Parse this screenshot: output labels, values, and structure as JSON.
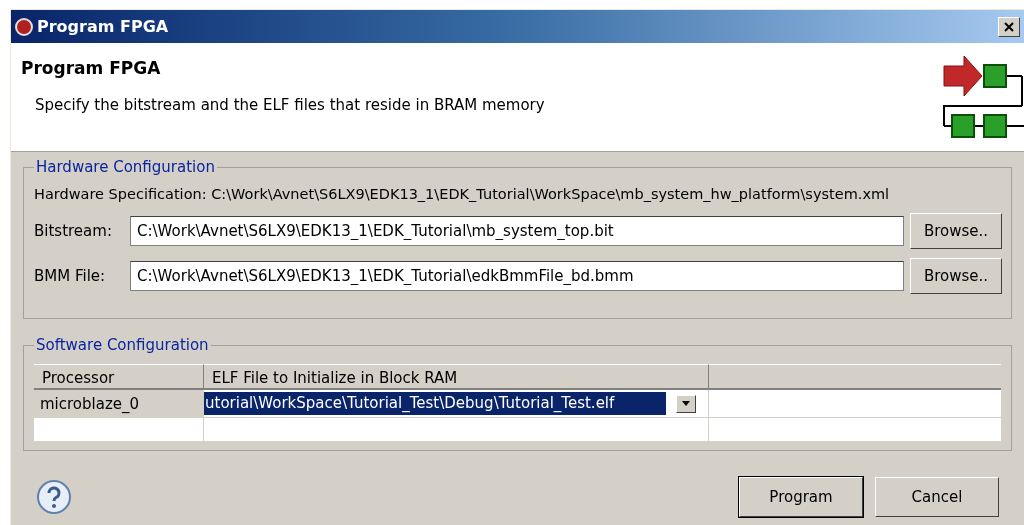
{
  "window": {
    "title": "Program FPGA"
  },
  "header": {
    "title": "Program FPGA",
    "description": "Specify the bitstream and the ELF files that reside in BRAM memory"
  },
  "hardware": {
    "legend": "Hardware Configuration",
    "spec_label": "Hardware Specification:",
    "spec_value": "C:\\Work\\Avnet\\S6LX9\\EDK13_1\\EDK_Tutorial\\WorkSpace\\mb_system_hw_platform\\system.xml",
    "fields": [
      {
        "label": "Bitstream:",
        "value": "C:\\Work\\Avnet\\S6LX9\\EDK13_1\\EDK_Tutorial\\mb_system_top.bit",
        "button": "Browse.."
      },
      {
        "label": "BMM File:",
        "value": "C:\\Work\\Avnet\\S6LX9\\EDK13_1\\EDK_Tutorial\\edkBmmFile_bd.bmm",
        "button": "Browse.."
      }
    ]
  },
  "software": {
    "legend": "Software Configuration",
    "table": {
      "columns": [
        "Processor",
        "ELF File to Initialize in Block RAM"
      ],
      "rows": [
        {
          "processor": "microblaze_0",
          "elf": "utorial\\WorkSpace\\Tutorial_Test\\Debug\\Tutorial_Test.elf",
          "selected": true
        }
      ]
    }
  },
  "buttons": [
    {
      "label": "Program",
      "default": true
    },
    {
      "label": "Cancel",
      "default": false
    }
  ]
}
